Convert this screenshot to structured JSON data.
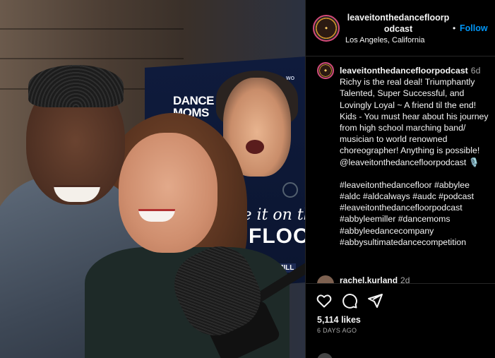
{
  "post": {
    "username_line1": "leaveitonthedancefloorp",
    "username_line2": "odcast",
    "follow_separator": "•",
    "follow_label": "Follow",
    "location": "Los Angeles, California"
  },
  "caption": {
    "username": "leaveitonthedancefloorpodcast",
    "time": "6d",
    "text": "Richy is the real deal! Triumphantly Talented, Super Successful, and Lovingly Loyal ~ A friend til the end! Kids - You must hear about his journey from high school marching band/ musician to world renowned choreographer! Anything is possible! @leaveitonthedancefloorpodcast 🎙️",
    "hashtags": "#leaveitonthedancefloor #abbylee\n#aldc #aldcalways #audc #podcast\n#leaveitonthedancefloorpodcast\n#abbyleemiller #dancemoms\n#abbyleedancecompany\n#abbysultimatedancecompetition"
  },
  "comment_preview": {
    "username": "rachel.kurland",
    "time": "2d"
  },
  "stats": {
    "likes": "5,114 likes",
    "date": "6 DAYS AGO"
  },
  "photo": {
    "poster_logo": "DANCE MOMS",
    "poster_small": "WO",
    "poster_script": "ave it on the",
    "poster_floor": "FLOO",
    "poster_badge": "MILL"
  },
  "icons": {
    "like": "heart-icon",
    "comment": "comment-icon",
    "share": "share-icon"
  },
  "colors": {
    "background": "#000000",
    "text": "#f5f5f5",
    "muted": "#a8a8a8",
    "follow": "#0095f6",
    "divider": "#262626",
    "avatar_ring": "#d24a79"
  }
}
